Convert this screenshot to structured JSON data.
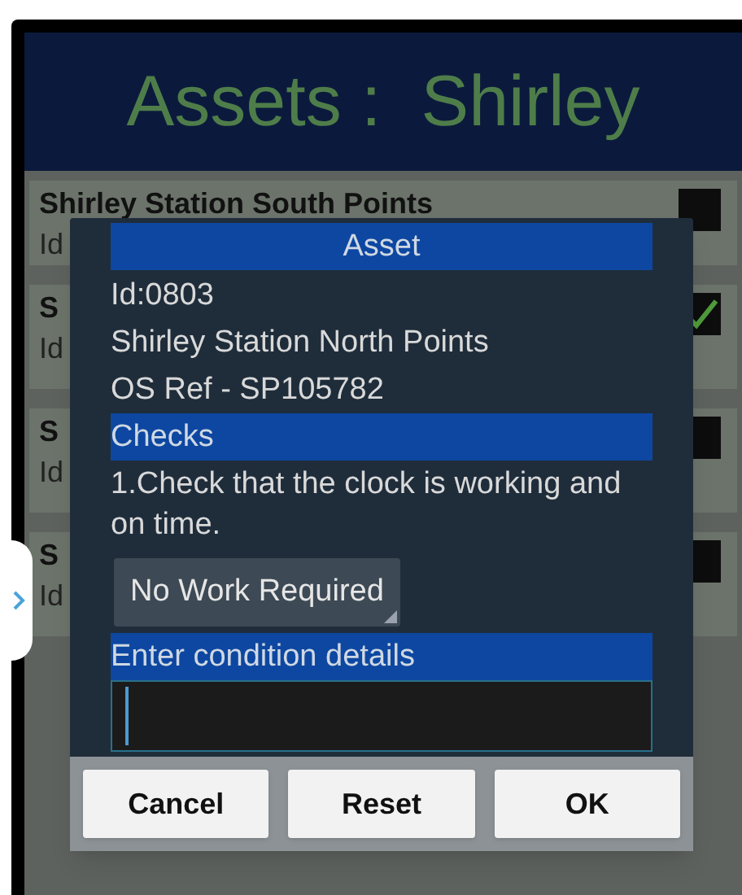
{
  "header": {
    "title": "Assets :  Shirley"
  },
  "assets": [
    {
      "name": "Shirley Station South Points",
      "id": "Id",
      "checked": false
    },
    {
      "name": "S",
      "id": "Id",
      "checked": true
    },
    {
      "name": "S",
      "id": "Id",
      "checked": false
    },
    {
      "name": "S",
      "id": "Id",
      "checked": false
    }
  ],
  "dialog": {
    "title": "Asset",
    "id": "Id:0803",
    "name": "Shirley Station North Points",
    "os_ref": "OS Ref - SP105782",
    "checks_heading": "Checks",
    "check_text": "1.Check that the clock is working and on time.",
    "dropdown_value": "No Work Required",
    "details_label": "Enter condition details",
    "buttons": [
      "Cancel",
      "Reset",
      "OK"
    ]
  }
}
